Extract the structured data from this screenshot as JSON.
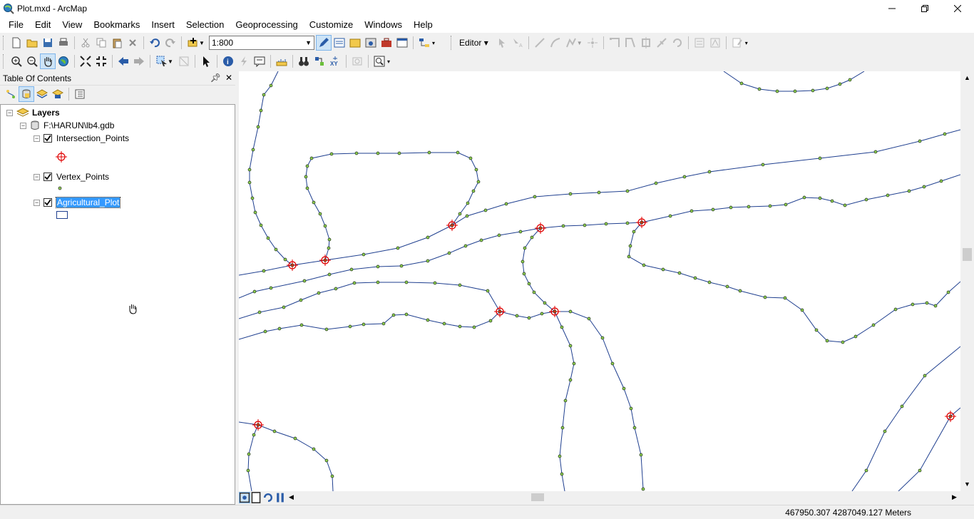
{
  "window": {
    "title": "Plot.mxd - ArcMap"
  },
  "menu": [
    "File",
    "Edit",
    "View",
    "Bookmarks",
    "Insert",
    "Selection",
    "Geoprocessing",
    "Customize",
    "Windows",
    "Help"
  ],
  "toolbar": {
    "scale": "1:800",
    "editor_label": "Editor"
  },
  "toc": {
    "title": "Table Of Contents",
    "root": "Layers",
    "database": "F:\\HARUN\\lb4.gdb",
    "layers": [
      {
        "name": "Intersection_Points",
        "checked": true,
        "symbol": "crosshair"
      },
      {
        "name": "Vertex_Points",
        "checked": true,
        "symbol": "dot"
      },
      {
        "name": "Agricultural_Plot",
        "checked": true,
        "symbol": "rectangle",
        "selected": true
      }
    ]
  },
  "status": {
    "coordinates": "467950.307  4287049.127 Meters"
  },
  "colors": {
    "line": "#1f3f8f",
    "vertex": "#8fd14f",
    "intersection": "#e00000",
    "selection": "#3399ff"
  }
}
